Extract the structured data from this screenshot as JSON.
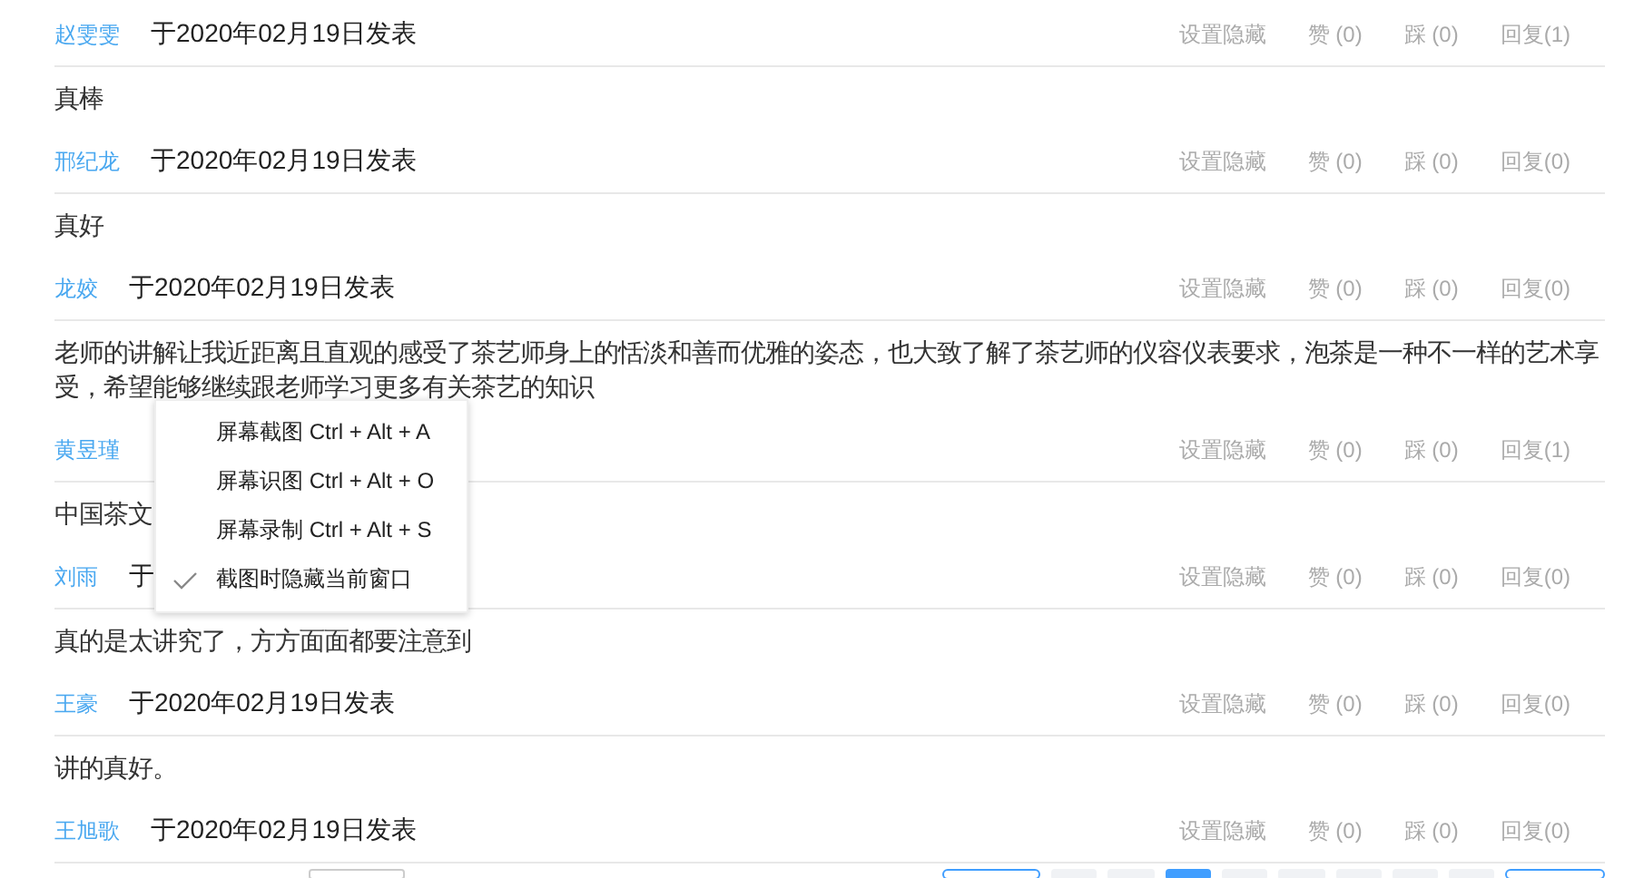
{
  "comments": [
    {
      "author": "赵雯雯",
      "date": "于2020年02月19日发表",
      "actions": [
        "设置隐藏",
        "赞 (0)",
        "踩 (0)",
        "回复(1)"
      ],
      "text": "真棒"
    },
    {
      "author": "邢纪龙",
      "date": "于2020年02月19日发表",
      "actions": [
        "设置隐藏",
        "赞 (0)",
        "踩 (0)",
        "回复(0)"
      ],
      "text": "真好"
    },
    {
      "author": "龙姣",
      "date": "于2020年02月19日发表",
      "actions": [
        "设置隐藏",
        "赞 (0)",
        "踩 (0)",
        "回复(0)"
      ],
      "text": "老师的讲解让我近距离且直观的感受了茶艺师身上的恬淡和善而优雅的姿态，也大致了解了茶艺师的仪容仪表要求，泡茶是一种不一样的艺术享受，希望能够继续跟老师学习更多有关茶艺的知识"
    },
    {
      "author": "黄昱瑾",
      "actions": [
        "设置隐藏",
        "赞 (0)",
        "踩 (0)",
        "回复(1)"
      ],
      "text": "中国茶文"
    },
    {
      "author": "刘雨",
      "date": "于",
      "actions": [
        "设置隐藏",
        "赞 (0)",
        "踩 (0)",
        "回复(0)"
      ],
      "text": "真的是太讲究了，方方面面都要注意到"
    },
    {
      "author": "王豪",
      "date": "于2020年02月19日发表",
      "actions": [
        "设置隐藏",
        "赞 (0)",
        "踩 (0)",
        "回复(0)"
      ],
      "text": "讲的真好。"
    },
    {
      "author": "王旭歌",
      "date": "于2020年02月19日发表",
      "actions": [
        "设置隐藏",
        "赞 (0)",
        "踩 (0)",
        "回复(0)"
      ]
    }
  ],
  "context_menu": {
    "items": [
      {
        "label": "屏幕截图 Ctrl + Alt + A",
        "checked": false
      },
      {
        "label": "屏幕识图 Ctrl + Alt + O",
        "checked": false
      },
      {
        "label": "屏幕录制 Ctrl + Alt + S",
        "checked": false
      },
      {
        "label": "截图时隐藏当前窗口",
        "checked": true
      }
    ]
  },
  "pagination": {
    "pages": [
      {
        "selected": false
      },
      {
        "selected": false
      },
      {
        "selected": true
      },
      {
        "selected": false
      },
      {
        "selected": false
      },
      {
        "selected": false
      },
      {
        "selected": false
      },
      {
        "selected": false
      }
    ]
  }
}
